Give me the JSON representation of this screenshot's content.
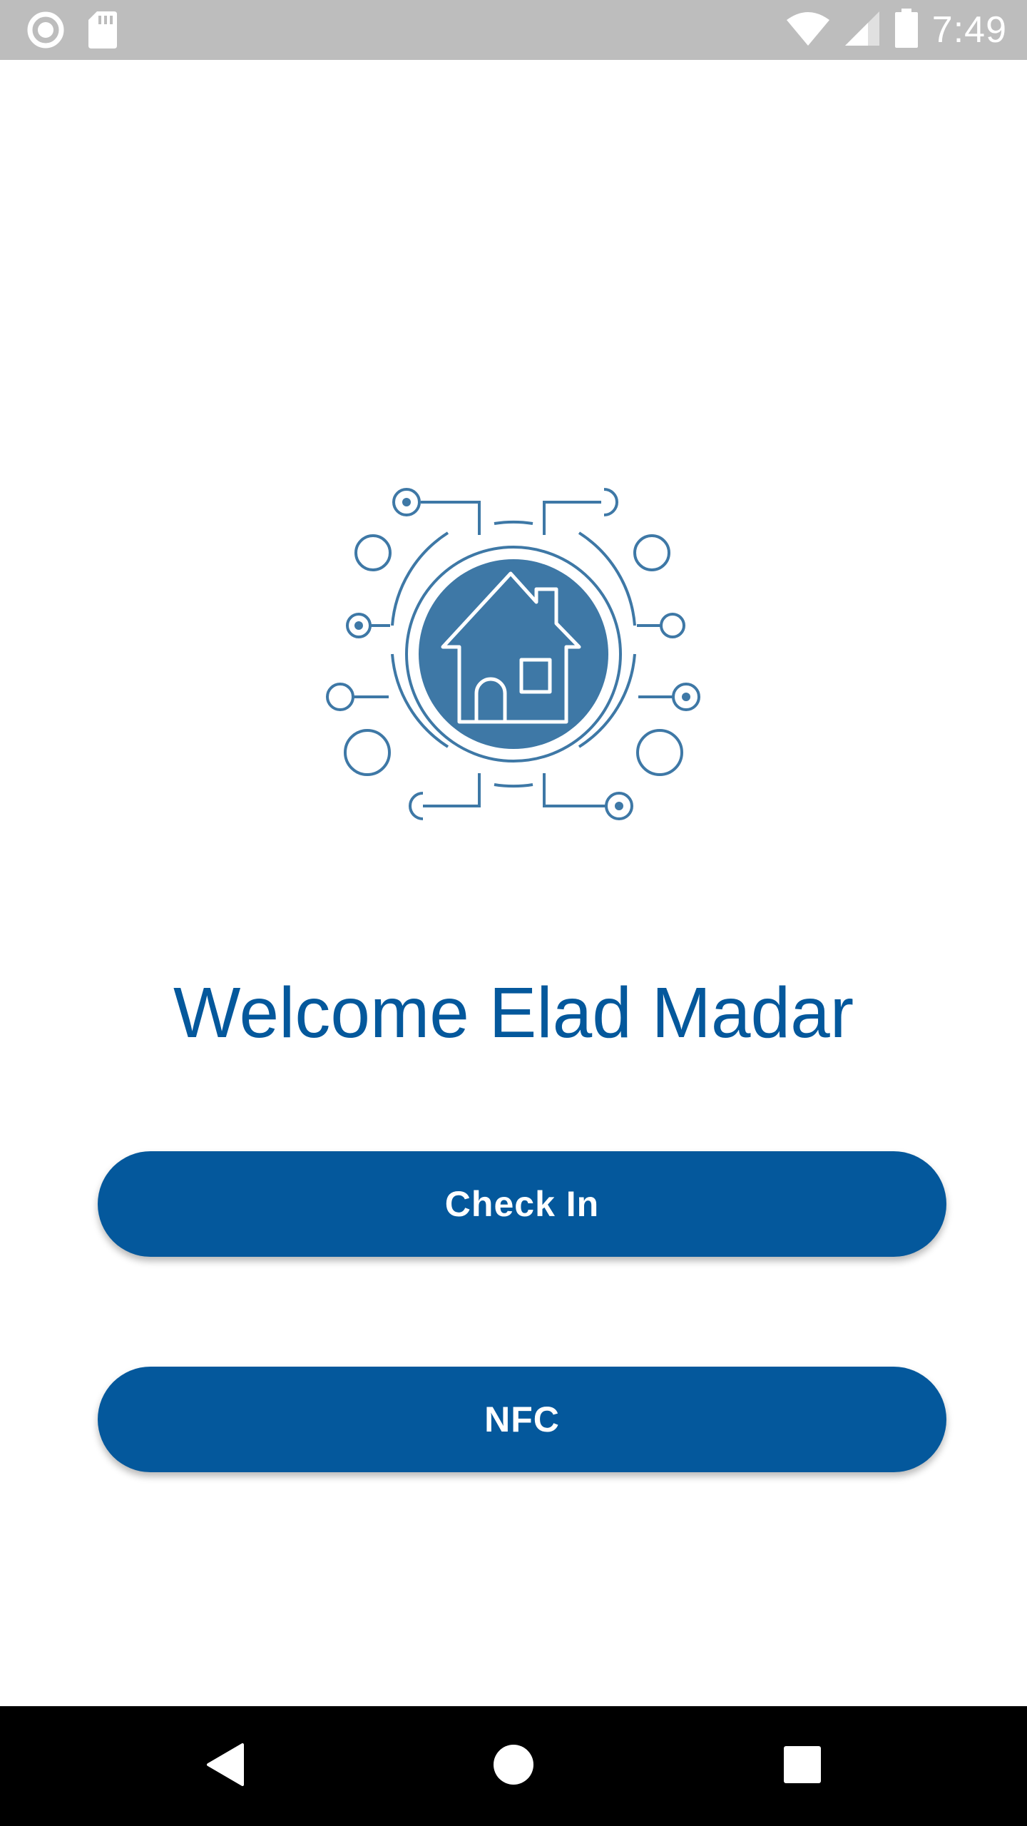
{
  "status_bar": {
    "time": "7:49",
    "icons": [
      "circle-record-icon",
      "sd-card-icon",
      "wifi-icon",
      "signal-icon",
      "battery-icon"
    ]
  },
  "main": {
    "logo_icon": "smart-home-circuit-icon",
    "welcome_text": "Welcome Elad Madar",
    "check_in_label": "Check In",
    "nfc_label": "NFC"
  },
  "nav_bar": {
    "icons": [
      "back-icon",
      "home-icon",
      "recents-icon"
    ]
  },
  "colors": {
    "primary": "#04589c",
    "logo_blue": "#3e78a6",
    "status_bar_bg": "#bdbdbd",
    "nav_bar_bg": "#000000"
  }
}
